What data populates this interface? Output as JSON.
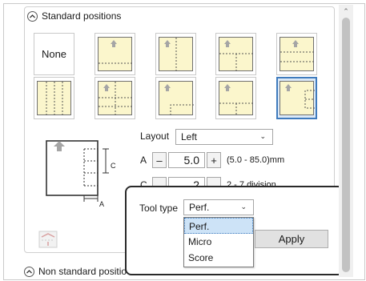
{
  "sections": {
    "standard_title": "Standard positions",
    "non_standard_title": "Non standard positio"
  },
  "thumbs": {
    "none_label": "None"
  },
  "layout": {
    "label": "Layout",
    "value": "Left"
  },
  "param_a": {
    "label": "A",
    "value": "5.0",
    "minus": "–",
    "plus": "+",
    "range": "(5.0 - 85.0)mm"
  },
  "param_c": {
    "label": "C",
    "value": "2",
    "range": "2 - 7 division"
  },
  "diagram": {
    "label_a": "A",
    "label_c": "C"
  },
  "tool_type": {
    "label": "Tool type",
    "value": "Perf.",
    "options": [
      "Perf.",
      "Micro",
      "Score"
    ]
  },
  "apply_label": "Apply",
  "colors": {
    "thumb_fill": "#fbf6cc",
    "selected_border": "#3f7bbd",
    "menu_highlight": "#cde3f7"
  }
}
